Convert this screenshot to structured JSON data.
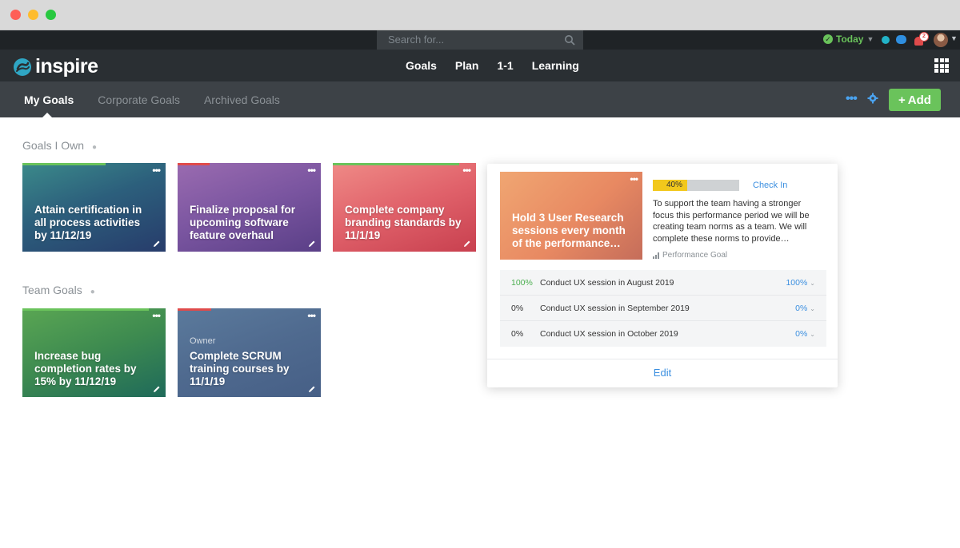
{
  "topbar": {
    "search_placeholder": "Search for...",
    "today_label": "Today",
    "notification_count": "2"
  },
  "brand": {
    "logo_text": "inspire"
  },
  "mainnav": {
    "items": [
      "Goals",
      "Plan",
      "1-1",
      "Learning"
    ]
  },
  "subnav": {
    "tabs": [
      "My Goals",
      "Corporate Goals",
      "Archived Goals"
    ],
    "more_label": "•••",
    "add_label": "Add"
  },
  "sections": {
    "goals_i_own": "Goals I Own",
    "team_goals": "Team Goals"
  },
  "cards": {
    "owned": [
      {
        "title": "Attain certification in all process activities by 11/12/19",
        "accent": "#6ac35b"
      },
      {
        "title": "Finalize proposal for upcoming software feature overhaul",
        "accent": "#e04b4b"
      },
      {
        "title": "Complete company branding standards by 11/1/19",
        "accent": "#6ac35b"
      }
    ],
    "team": [
      {
        "title": "Increase bug completion rates by 15% by 11/12/19",
        "accent": "#6ac35b"
      },
      {
        "title": "Complete SCRUM training courses by 11/1/19",
        "owner_label": "Owner",
        "accent": "#e04b4b"
      }
    ],
    "more_label": "•••"
  },
  "popover": {
    "card_title": "Hold 3 User Research sessions every month of the performance…",
    "progress_label": "40%",
    "progress_value": 40,
    "check_in": "Check In",
    "description": "To support the team having a stronger focus this performance period we will be creating team norms as a team. We will complete these norms to provide…",
    "goal_type": "Performance Goal",
    "milestones": [
      {
        "pct": "100%",
        "title": "Conduct UX session in August 2019",
        "value": "100%"
      },
      {
        "pct": "0%",
        "title": "Conduct UX session in September 2019",
        "value": "0%"
      },
      {
        "pct": "0%",
        "title": "Conduct UX session in October 2019",
        "value": "0%"
      }
    ],
    "edit_label": "Edit"
  },
  "colors": {
    "accent_green": "#6ac35b",
    "accent_blue": "#3b8fe0",
    "progress_yellow": "#f2c81c"
  }
}
